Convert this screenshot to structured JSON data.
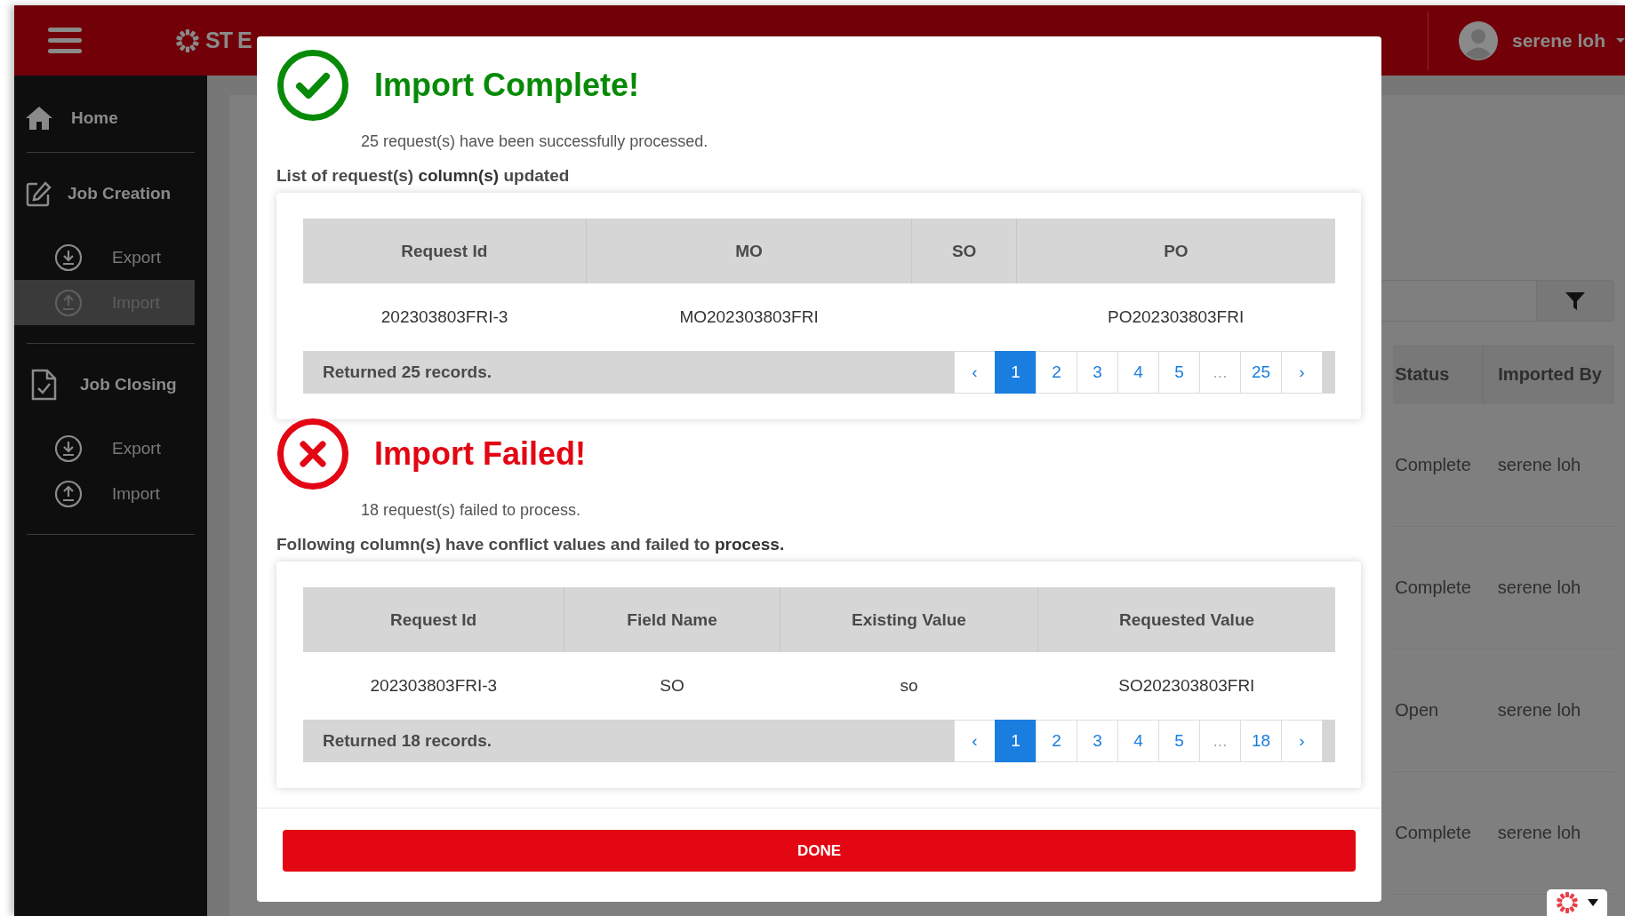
{
  "header": {
    "brand": "ST E",
    "user": "serene loh"
  },
  "sidebar": {
    "items": [
      {
        "label": "Home",
        "selected": false
      },
      {
        "label": "Job Creation",
        "selected": false,
        "children": [
          {
            "label": "Export",
            "selected": false
          },
          {
            "label": "Import",
            "selected": true
          }
        ]
      },
      {
        "label": "Job Closing",
        "selected": false,
        "children": [
          {
            "label": "Export",
            "selected": false
          },
          {
            "label": "Import",
            "selected": false
          }
        ]
      }
    ]
  },
  "background_table": {
    "columns": [
      "Status",
      "Imported By"
    ],
    "rows": [
      [
        "Complete",
        "serene loh"
      ],
      [
        "Complete",
        "serene loh"
      ],
      [
        "Open",
        "serene loh"
      ],
      [
        "Complete",
        "serene loh"
      ]
    ]
  },
  "modal": {
    "sections": [
      {
        "kind": "success",
        "title": "Import Complete!",
        "message": "25 request(s) have been successfully processed.",
        "caption": "List of request(s) **column(s)** updated",
        "table": {
          "columns": [
            "Request Id",
            "MO",
            "SO",
            "PO"
          ],
          "rows": [
            [
              "202303803FRI-3",
              "MO202303803FRI",
              null,
              "PO202303803FRI"
            ]
          ],
          "footer": "Returned 25 records.",
          "pages": [
            {
              "label": "‹",
              "selected": false
            },
            {
              "label": "1",
              "selected": true
            },
            {
              "label": "2",
              "selected": false
            },
            {
              "label": "3",
              "selected": false
            },
            {
              "label": "4",
              "selected": false
            },
            {
              "label": "5",
              "selected": false
            },
            {
              "label": "...",
              "selected": false
            },
            {
              "label": "25",
              "selected": false
            },
            {
              "label": "›",
              "selected": false
            }
          ]
        }
      },
      {
        "kind": "failure",
        "title": "Import Failed!",
        "message": "18 request(s) failed to process.",
        "caption": "Following column(s) have conflict values and failed to **process.**",
        "table": {
          "columns": [
            "Request Id",
            "Field Name",
            "Existing Value",
            "Requested Value"
          ],
          "rows": [
            [
              "202303803FRI-3",
              "SO",
              "so",
              "SO202303803FRI"
            ]
          ],
          "footer": "Returned 18 records.",
          "pages": [
            {
              "label": "‹",
              "selected": false
            },
            {
              "label": "1",
              "selected": true
            },
            {
              "label": "2",
              "selected": false
            },
            {
              "label": "3",
              "selected": false
            },
            {
              "label": "4",
              "selected": false
            },
            {
              "label": "5",
              "selected": false
            },
            {
              "label": "...",
              "selected": false
            },
            {
              "label": "18",
              "selected": false
            },
            {
              "label": "›",
              "selected": false
            }
          ]
        }
      }
    ],
    "button": "DONE"
  }
}
